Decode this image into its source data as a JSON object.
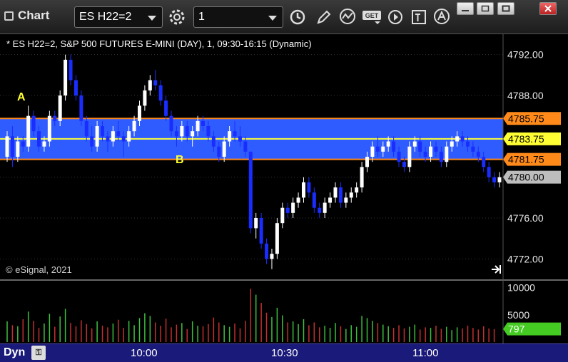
{
  "window": {
    "title": "Chart",
    "symbol_input": "ES H22=2",
    "interval_input": "1"
  },
  "chart": {
    "info_line": "* ES H22=2, S&P 500 FUTURES E-MINI (DAY), 1, 09:30-16:15 (Dynamic)",
    "copyright": "© eSignal, 2021",
    "price_axis": [
      "4792.00",
      "4788.00",
      "4784.00",
      "4780.00",
      "4776.00",
      "4772.00"
    ],
    "tags": {
      "upper": "4785.75",
      "mid": "4783.75",
      "lower": "4781.75",
      "last": "4780.00"
    },
    "annotations": {
      "a": "A",
      "b": "B"
    },
    "volume_axis": [
      "10000",
      "5000"
    ],
    "volume_tag": "797",
    "time_axis": [
      "10:00",
      "10:30",
      "11:00"
    ],
    "dyn_label": "Dyn",
    "colors": {
      "band": "#2f5cff",
      "band_edge": "#ff8a1a",
      "mid_line": "#ffff33",
      "up": "#ffffff",
      "down": "#1a2dff",
      "vol_up": "#3fbf3f",
      "vol_down": "#c23030",
      "vol_tag": "#44cc22"
    }
  },
  "chart_data": {
    "type": "candlestick",
    "ylim": [
      4770,
      4794
    ],
    "price_ticks": [
      4772,
      4776,
      4780,
      4784,
      4788,
      4792
    ],
    "bands": {
      "upper": 4785.75,
      "mid": 4783.75,
      "lower": 4781.75
    },
    "last_price": 4780.0,
    "volume_ylim": [
      0,
      11000
    ],
    "volume_ticks": [
      5000,
      10000
    ],
    "candles": [
      [
        4782.0,
        4784.5,
        4781.5,
        4784.0
      ],
      [
        4784.0,
        4785.0,
        4781.0,
        4782.0
      ],
      [
        4782.0,
        4784.0,
        4781.5,
        4783.5
      ],
      [
        4783.5,
        4784.0,
        4782.5,
        4783.0
      ],
      [
        4783.0,
        4787.0,
        4782.5,
        4786.0
      ],
      [
        4786.0,
        4786.5,
        4784.0,
        4784.5
      ],
      [
        4784.5,
        4785.0,
        4782.5,
        4783.0
      ],
      [
        4783.0,
        4784.0,
        4782.5,
        4783.5
      ],
      [
        4783.5,
        4786.5,
        4783.0,
        4786.0
      ],
      [
        4786.0,
        4786.5,
        4785.0,
        4785.5
      ],
      [
        4785.5,
        4788.5,
        4785.0,
        4788.0
      ],
      [
        4788.0,
        4792.0,
        4787.5,
        4791.5
      ],
      [
        4791.5,
        4792.0,
        4789.0,
        4789.5
      ],
      [
        4789.5,
        4790.0,
        4787.5,
        4788.0
      ],
      [
        4788.0,
        4788.5,
        4785.0,
        4785.5
      ],
      [
        4785.5,
        4786.0,
        4783.5,
        4784.0
      ],
      [
        4784.0,
        4785.0,
        4782.5,
        4783.0
      ],
      [
        4783.0,
        4785.5,
        4782.5,
        4785.0
      ],
      [
        4785.0,
        4785.5,
        4783.5,
        4784.0
      ],
      [
        4784.0,
        4784.5,
        4782.5,
        4783.5
      ],
      [
        4783.5,
        4785.0,
        4783.0,
        4784.5
      ],
      [
        4784.5,
        4785.5,
        4783.5,
        4784.0
      ],
      [
        4784.0,
        4784.5,
        4782.0,
        4783.5
      ],
      [
        4783.5,
        4785.0,
        4783.0,
        4784.5
      ],
      [
        4784.5,
        4786.0,
        4784.0,
        4785.5
      ],
      [
        4785.5,
        4787.5,
        4785.0,
        4787.0
      ],
      [
        4787.0,
        4789.0,
        4786.5,
        4788.5
      ],
      [
        4788.5,
        4790.0,
        4788.0,
        4789.5
      ],
      [
        4789.5,
        4790.5,
        4788.5,
        4789.0
      ],
      [
        4789.0,
        4789.5,
        4787.0,
        4787.5
      ],
      [
        4787.5,
        4788.0,
        4785.5,
        4786.0
      ],
      [
        4786.0,
        4786.5,
        4784.0,
        4784.5
      ],
      [
        4784.5,
        4785.0,
        4783.0,
        4784.0
      ],
      [
        4784.0,
        4785.5,
        4783.5,
        4785.0
      ],
      [
        4785.0,
        4785.5,
        4783.5,
        4784.0
      ],
      [
        4784.0,
        4785.0,
        4783.0,
        4784.5
      ],
      [
        4784.5,
        4786.0,
        4784.0,
        4785.5
      ],
      [
        4785.5,
        4786.0,
        4784.5,
        4785.0
      ],
      [
        4785.0,
        4785.5,
        4783.5,
        4784.0
      ],
      [
        4784.0,
        4784.5,
        4782.5,
        4783.0
      ],
      [
        4783.0,
        4783.5,
        4781.5,
        4782.0
      ],
      [
        4782.0,
        4784.0,
        4781.5,
        4783.5
      ],
      [
        4783.5,
        4785.0,
        4783.0,
        4784.5
      ],
      [
        4784.5,
        4785.5,
        4783.5,
        4784.0
      ],
      [
        4784.0,
        4785.0,
        4783.0,
        4783.5
      ],
      [
        4783.5,
        4784.0,
        4782.0,
        4782.5
      ],
      [
        4782.5,
        4782.5,
        4774.5,
        4775.0
      ],
      [
        4775.0,
        4776.5,
        4774.0,
        4776.0
      ],
      [
        4776.0,
        4776.5,
        4773.0,
        4773.5
      ],
      [
        4773.5,
        4774.0,
        4771.5,
        4772.0
      ],
      [
        4772.0,
        4773.0,
        4771.0,
        4772.5
      ],
      [
        4772.5,
        4776.0,
        4772.0,
        4775.5
      ],
      [
        4775.5,
        4777.5,
        4775.0,
        4777.0
      ],
      [
        4777.0,
        4777.5,
        4776.0,
        4776.5
      ],
      [
        4776.5,
        4778.0,
        4776.0,
        4777.5
      ],
      [
        4777.5,
        4778.5,
        4777.0,
        4778.0
      ],
      [
        4778.0,
        4780.0,
        4777.5,
        4779.5
      ],
      [
        4779.5,
        4780.0,
        4778.0,
        4778.5
      ],
      [
        4778.5,
        4779.0,
        4776.5,
        4777.0
      ],
      [
        4777.0,
        4777.5,
        4776.0,
        4776.5
      ],
      [
        4776.5,
        4778.0,
        4776.0,
        4777.5
      ],
      [
        4777.5,
        4778.5,
        4777.0,
        4778.0
      ],
      [
        4778.0,
        4779.5,
        4777.5,
        4779.0
      ],
      [
        4779.0,
        4779.5,
        4777.0,
        4777.5
      ],
      [
        4777.5,
        4778.5,
        4777.0,
        4778.0
      ],
      [
        4778.0,
        4779.0,
        4777.5,
        4778.5
      ],
      [
        4778.5,
        4779.5,
        4778.0,
        4779.0
      ],
      [
        4779.0,
        4781.5,
        4778.5,
        4781.0
      ],
      [
        4781.0,
        4782.5,
        4780.5,
        4782.0
      ],
      [
        4782.0,
        4783.5,
        4781.5,
        4783.0
      ],
      [
        4783.0,
        4784.0,
        4782.0,
        4782.5
      ],
      [
        4782.5,
        4783.5,
        4782.0,
        4783.0
      ],
      [
        4783.0,
        4784.0,
        4782.5,
        4783.5
      ],
      [
        4783.5,
        4784.0,
        4782.0,
        4782.5
      ],
      [
        4782.5,
        4783.0,
        4781.0,
        4781.5
      ],
      [
        4781.5,
        4782.0,
        4780.5,
        4781.0
      ],
      [
        4781.0,
        4783.5,
        4780.5,
        4783.0
      ],
      [
        4783.0,
        4784.0,
        4782.5,
        4783.5
      ],
      [
        4783.5,
        4784.0,
        4782.0,
        4782.5
      ],
      [
        4782.5,
        4783.0,
        4781.5,
        4782.0
      ],
      [
        4782.0,
        4783.5,
        4781.5,
        4783.0
      ],
      [
        4783.0,
        4783.5,
        4782.0,
        4782.5
      ],
      [
        4782.5,
        4783.0,
        4781.0,
        4781.5
      ],
      [
        4781.5,
        4783.5,
        4781.0,
        4783.0
      ],
      [
        4783.0,
        4784.0,
        4782.5,
        4783.5
      ],
      [
        4783.5,
        4784.5,
        4783.0,
        4784.0
      ],
      [
        4784.0,
        4784.5,
        4783.0,
        4783.5
      ],
      [
        4783.5,
        4784.0,
        4782.5,
        4783.0
      ],
      [
        4783.0,
        4783.5,
        4782.0,
        4782.5
      ],
      [
        4782.5,
        4783.0,
        4781.5,
        4782.0
      ],
      [
        4782.0,
        4782.5,
        4780.5,
        4781.0
      ],
      [
        4781.0,
        4781.5,
        4779.5,
        4780.0
      ],
      [
        4780.0,
        4780.5,
        4779.0,
        4779.5
      ],
      [
        4779.5,
        4780.5,
        4779.0,
        4780.0
      ]
    ],
    "volume": [
      3800,
      3100,
      2900,
      4200,
      5600,
      3900,
      2600,
      3400,
      5200,
      2800,
      4700,
      6100,
      3500,
      2900,
      4000,
      3300,
      2500,
      3800,
      3000,
      2700,
      3400,
      4100,
      2600,
      3900,
      3100,
      4400,
      5300,
      4800,
      3600,
      3000,
      4300,
      2700,
      3200,
      3500,
      2400,
      3800,
      3000,
      2900,
      3300,
      4500,
      3600,
      3100,
      2800,
      3400,
      2500,
      3900,
      9800,
      8700,
      7200,
      5400,
      4600,
      6300,
      4900,
      3600,
      3800,
      3300,
      4200,
      3100,
      3600,
      2700,
      3000,
      2600,
      3500,
      2900,
      2400,
      3100,
      2800,
      4800,
      4400,
      3900,
      3500,
      3200,
      2900,
      2600,
      3100,
      2500,
      2800,
      3200,
      2300,
      2700,
      2600,
      3000,
      2400,
      2800,
      2200,
      2700,
      2500,
      3000,
      2600,
      2300,
      2900,
      2500,
      2400
    ]
  }
}
